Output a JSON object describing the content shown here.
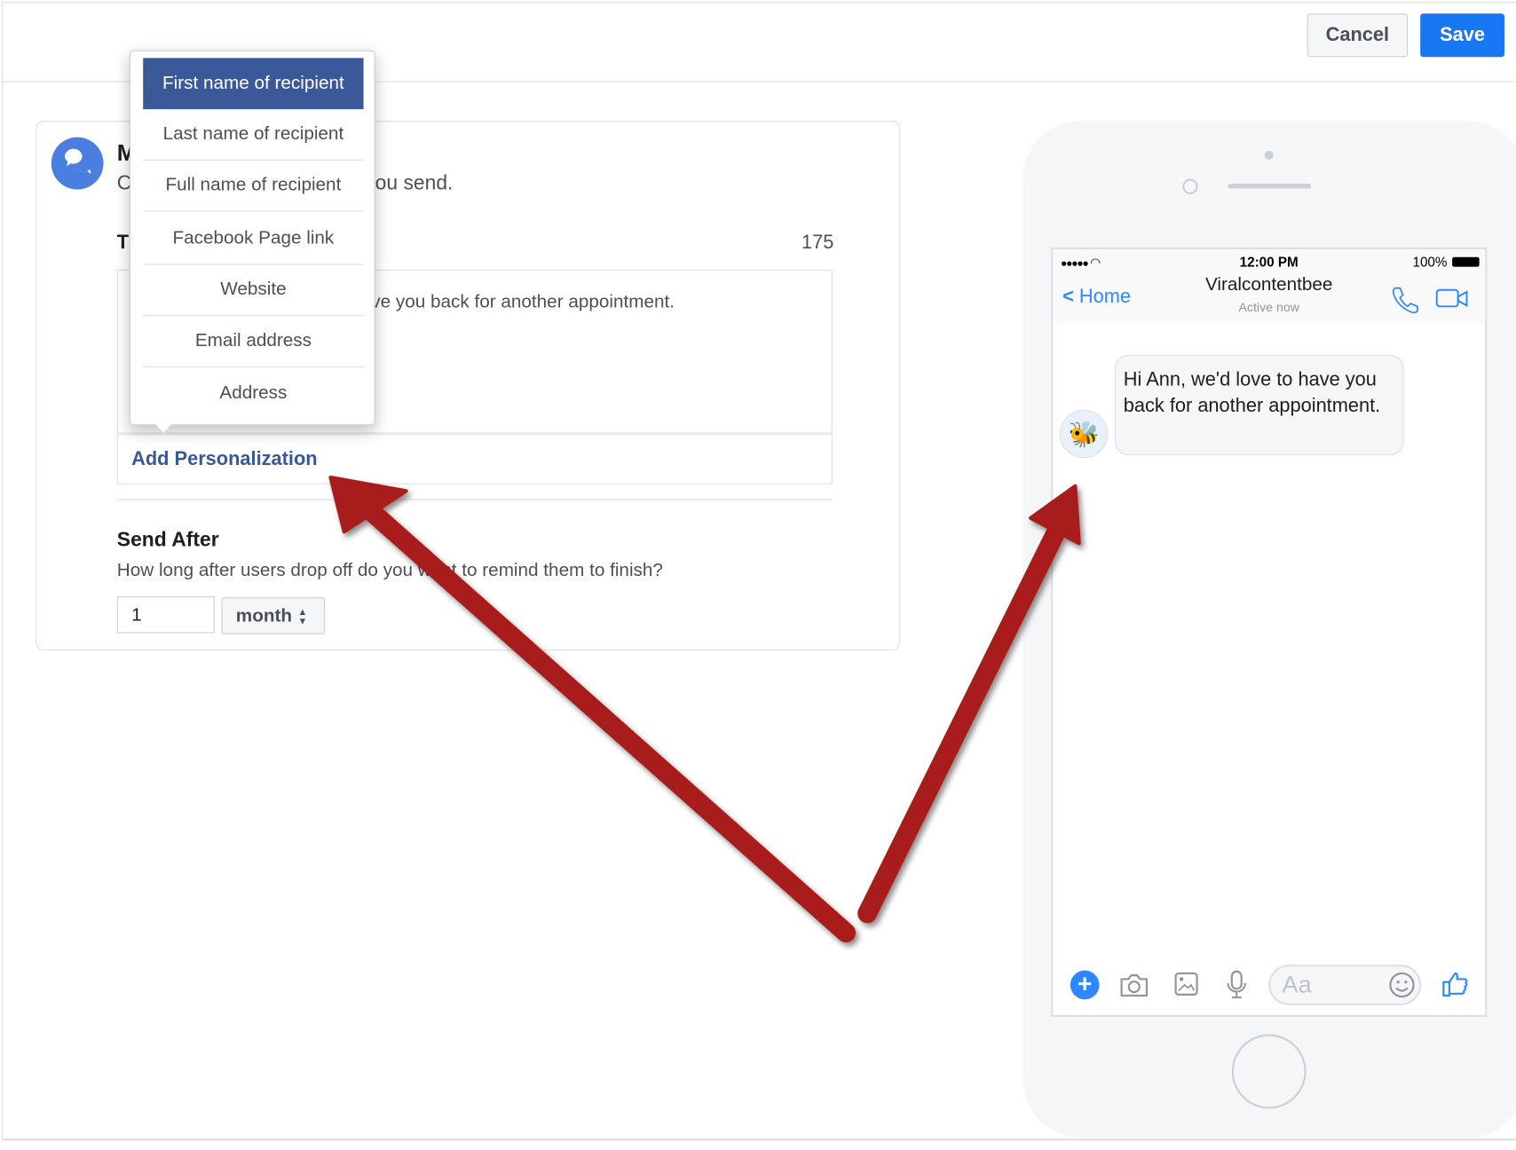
{
  "toolbar": {
    "cancel_label": "Cancel",
    "save_label": "Save"
  },
  "colors": {
    "accent": "#1877f2",
    "menu_selected": "#3b5998",
    "link": "#385898",
    "arrow": "#a91e1e"
  },
  "card": {
    "icon": "messenger-bubbles-icon",
    "title_visible": "M",
    "subtitle_start": "C",
    "subtitle_end": "ou send.",
    "text_label_visible": "T",
    "char_count": "175",
    "message_visible": "ve you back for another appointment.",
    "add_personalization": "Add Personalization",
    "send_after": {
      "title": "Send After",
      "question": "How long after users drop off do you want to remind them to finish?",
      "value": "1",
      "unit": "month"
    }
  },
  "personalization_menu": {
    "selected": 0,
    "items": [
      "First name of recipient",
      "Last name of recipient",
      "Full name of recipient",
      "Facebook Page link",
      "Website",
      "Email address",
      "Address"
    ]
  },
  "phone": {
    "status": {
      "time": "12:00 PM",
      "battery": "100%"
    },
    "header": {
      "back": "Home",
      "name": "Viralcontentbee",
      "status": "Active now"
    },
    "message": "Hi Ann, we'd love to have you back for another appointment.",
    "composer_placeholder": "Aa",
    "icons": [
      "plus-icon",
      "camera-icon",
      "image-icon",
      "microphone-icon",
      "emoji-icon",
      "thumbs-up-icon"
    ]
  }
}
